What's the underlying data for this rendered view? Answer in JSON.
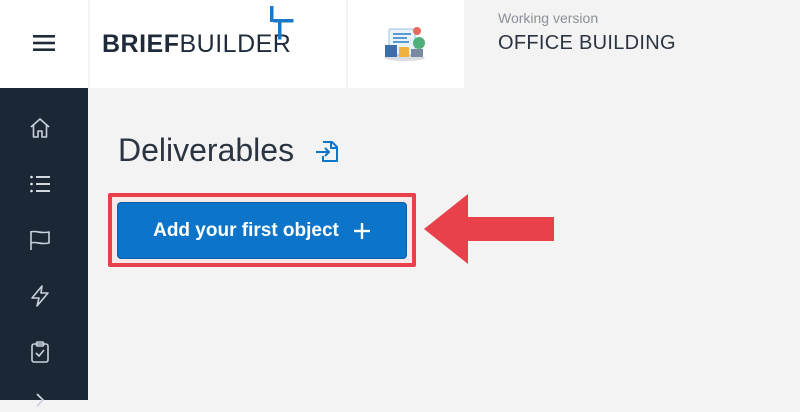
{
  "header": {
    "logo": {
      "brief": "BRIEF",
      "builder": "BUILDER"
    },
    "version_label": "Working version",
    "project_name": "OFFICE BUILDING"
  },
  "sidebar": {
    "items": [
      {
        "icon": "home-icon"
      },
      {
        "icon": "list-icon"
      },
      {
        "icon": "flag-icon"
      },
      {
        "icon": "lightning-icon"
      },
      {
        "icon": "clipboard-check-icon"
      },
      {
        "icon": "chevron-right-icon"
      }
    ]
  },
  "main": {
    "title": "Deliverables",
    "add_button_label": "Add your first object"
  },
  "colors": {
    "sidebar_bg": "#1c2736",
    "primary_button": "#0c75c9",
    "highlight": "#e8414b",
    "logo_accent": "#1a78c8"
  }
}
